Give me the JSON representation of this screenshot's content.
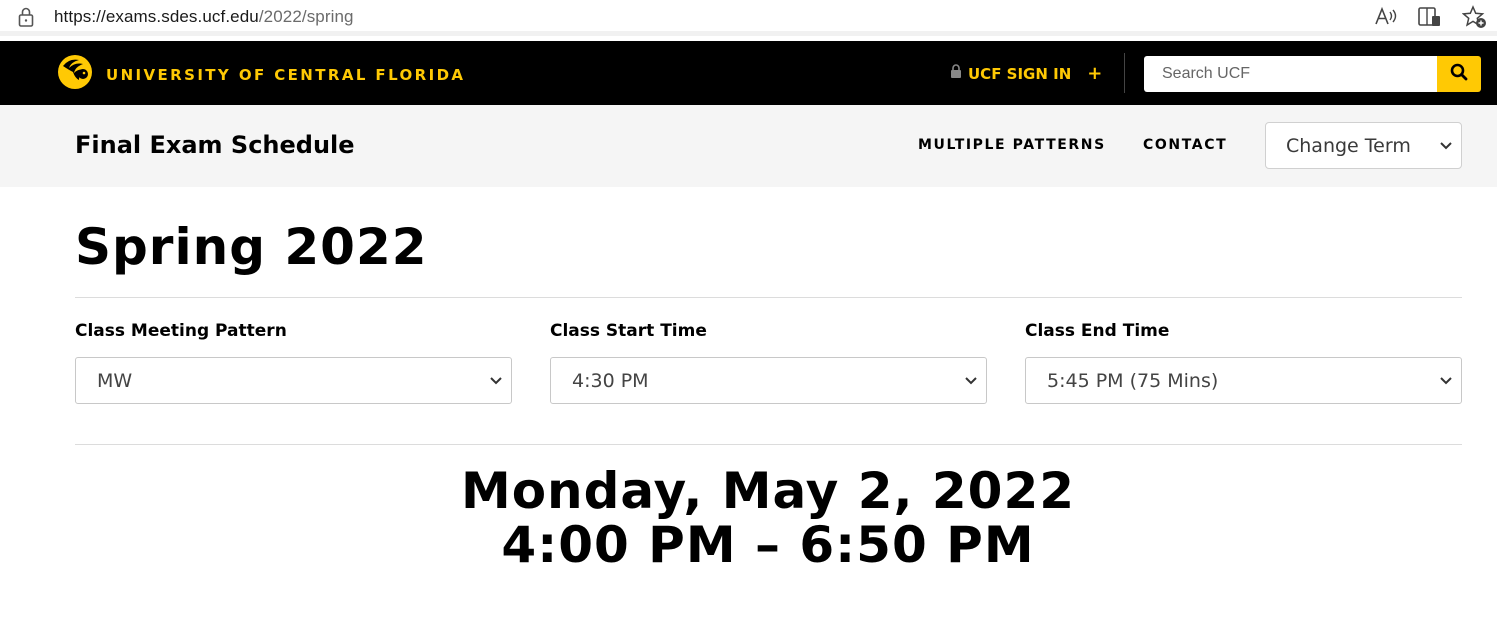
{
  "browser": {
    "url_host": "https://exams.sdes.ucf.edu",
    "url_path": "/2022/spring",
    "icons": [
      "lock-icon",
      "read-aloud-icon",
      "immersive-reader-icon",
      "add-favorite-icon"
    ]
  },
  "ucf_header": {
    "wordmark": "UNIVERSITY OF CENTRAL FLORIDA",
    "signin_label": "UCF SIGN IN",
    "signin_plus": "+",
    "search_placeholder": "Search UCF",
    "brand_color": "#ffc904"
  },
  "site_header": {
    "title": "Final Exam Schedule",
    "nav": [
      "MULTIPLE PATTERNS",
      "CONTACT"
    ],
    "term_select": "Change Term"
  },
  "main": {
    "heading": "Spring 2022",
    "fields": [
      {
        "label": "Class Meeting Pattern",
        "value": "MW"
      },
      {
        "label": "Class Start Time",
        "value": "4:30 PM"
      },
      {
        "label": "Class End Time",
        "value": "5:45 PM (75 Mins)"
      }
    ],
    "result_date": "Monday, May 2, 2022",
    "result_time": "4:00 PM – 6:50 PM"
  }
}
